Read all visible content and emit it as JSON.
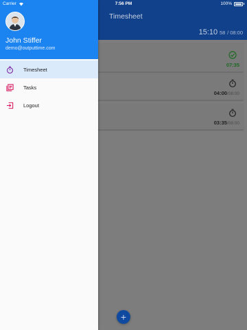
{
  "status_bar": {
    "carrier": "Carrier",
    "time": "7:56 PM",
    "battery": "100%"
  },
  "app": {
    "title": "Timesheet",
    "total_worked": "15:10",
    "total_small": "58",
    "total_goal": "/ 08:00",
    "fab_label": "+"
  },
  "cards": [
    {
      "icon": "check-circle-icon",
      "worked": "07:35",
      "goal": "",
      "status_color": "#1e6a22"
    },
    {
      "icon": "stopwatch-icon",
      "worked": "04:00",
      "goal": "/08:00"
    },
    {
      "icon": "stopwatch-icon",
      "worked": "03:35",
      "goal": "/08:00"
    }
  ],
  "drawer": {
    "user_name": "John Stiffer",
    "user_email": "demo@outputtime.com",
    "header_color": "#1c84f0",
    "items": [
      {
        "label": "Timesheet",
        "icon": "stopwatch-icon",
        "color": "#7b1fa2",
        "active": true
      },
      {
        "label": "Tasks",
        "icon": "tasks-icon",
        "color": "#d81b60"
      },
      {
        "label": "Logout",
        "icon": "logout-icon",
        "color": "#d81b60"
      }
    ]
  }
}
